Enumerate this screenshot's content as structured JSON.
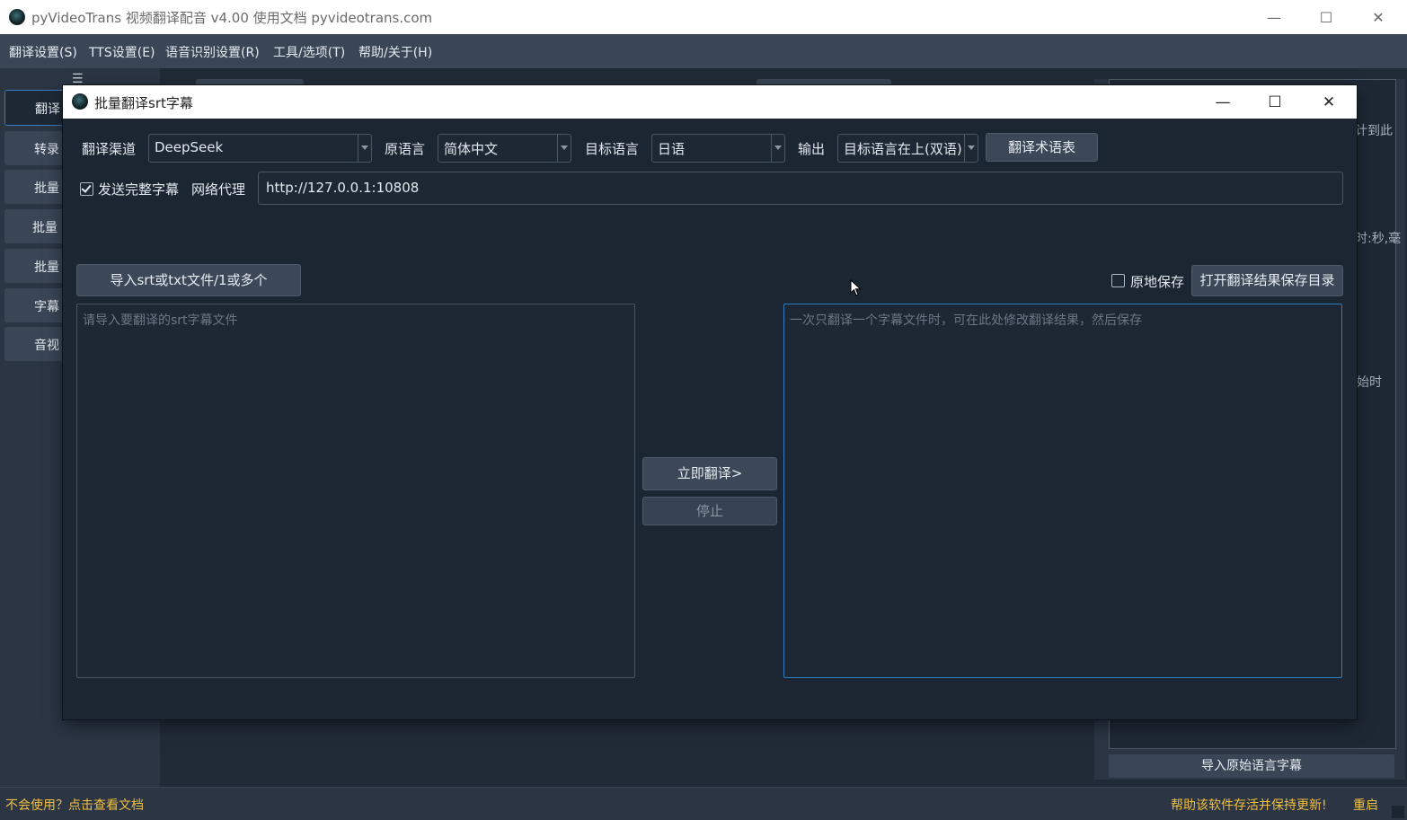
{
  "main_window": {
    "title": "pyVideoTrans 视频翻译配音 v4.00 使用文档 pyvideotrans.com",
    "minimize": "—",
    "maximize": "☐",
    "close": "✕"
  },
  "menubar": {
    "items": [
      "翻译设置(S)",
      "TTS设置(E)",
      "语音识别设置(R)",
      "工具/选项(T)",
      "帮助/关于(H)"
    ]
  },
  "sidebar": {
    "hamburger": "☰",
    "items": [
      "翻译",
      "转录",
      "批量",
      "批量",
      "批量",
      "字幕",
      "音视"
    ]
  },
  "right_panel": {
    "texts": [
      "计到此",
      "时:秒,毫",
      "始时"
    ],
    "import_original_label": "导入原始语言字幕"
  },
  "statusbar": {
    "help_link": "不会使用？点击查看文档",
    "support_text": "帮助该软件存活并保持更新!",
    "restart": "重启"
  },
  "dialog": {
    "title": "批量翻译srt字幕",
    "minimize": "—",
    "maximize": "☐",
    "close": "✕",
    "channel_label": "翻译渠道",
    "channel_value": "DeepSeek",
    "source_label": "原语言",
    "source_value": "简体中文",
    "target_label": "目标语言",
    "target_value": "日语",
    "output_label": "输出",
    "output_value": "目标语言在上(双语)",
    "glossary_button": "翻译术语表",
    "send_full_label": "发送完整字幕",
    "send_full_checked": true,
    "proxy_label": "网络代理",
    "proxy_value": "http://127.0.0.1:10808",
    "import_button": "导入srt或txt文件/1或多个",
    "save_in_place_label": "原地保存",
    "save_in_place_checked": false,
    "open_result_dir_button": "打开翻译结果保存目录",
    "source_placeholder": "请导入要翻译的srt字幕文件",
    "result_placeholder": "一次只翻译一个字幕文件时，可在此处修改翻译结果，然后保存",
    "translate_button": "立即翻译>",
    "stop_button": "停止"
  },
  "icons": {
    "app": "app-logo-icon",
    "arrow": "combo-arrow-icon"
  }
}
